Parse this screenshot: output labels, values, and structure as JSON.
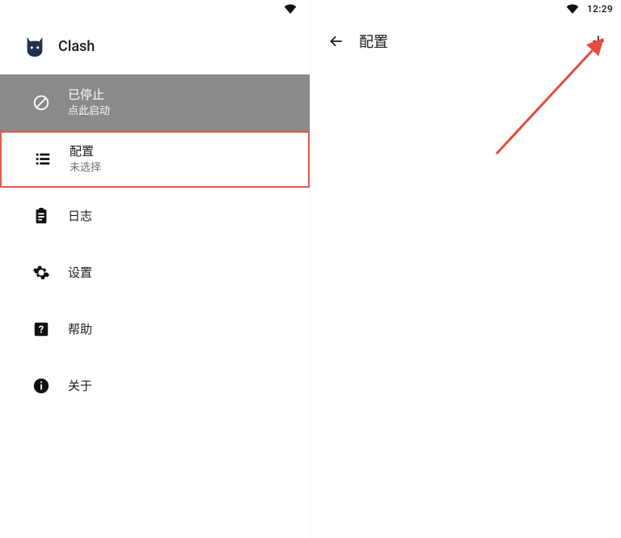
{
  "app": {
    "name": "Clash"
  },
  "left": {
    "status": {
      "title": "已停止",
      "subtitle": "点此启动"
    },
    "config": {
      "title": "配置",
      "subtitle": "未选择"
    },
    "logs": {
      "title": "日志"
    },
    "settings": {
      "title": "设置"
    },
    "help": {
      "title": "帮助"
    },
    "about": {
      "title": "关于"
    }
  },
  "right": {
    "title": "配置",
    "clock": "12:29"
  }
}
